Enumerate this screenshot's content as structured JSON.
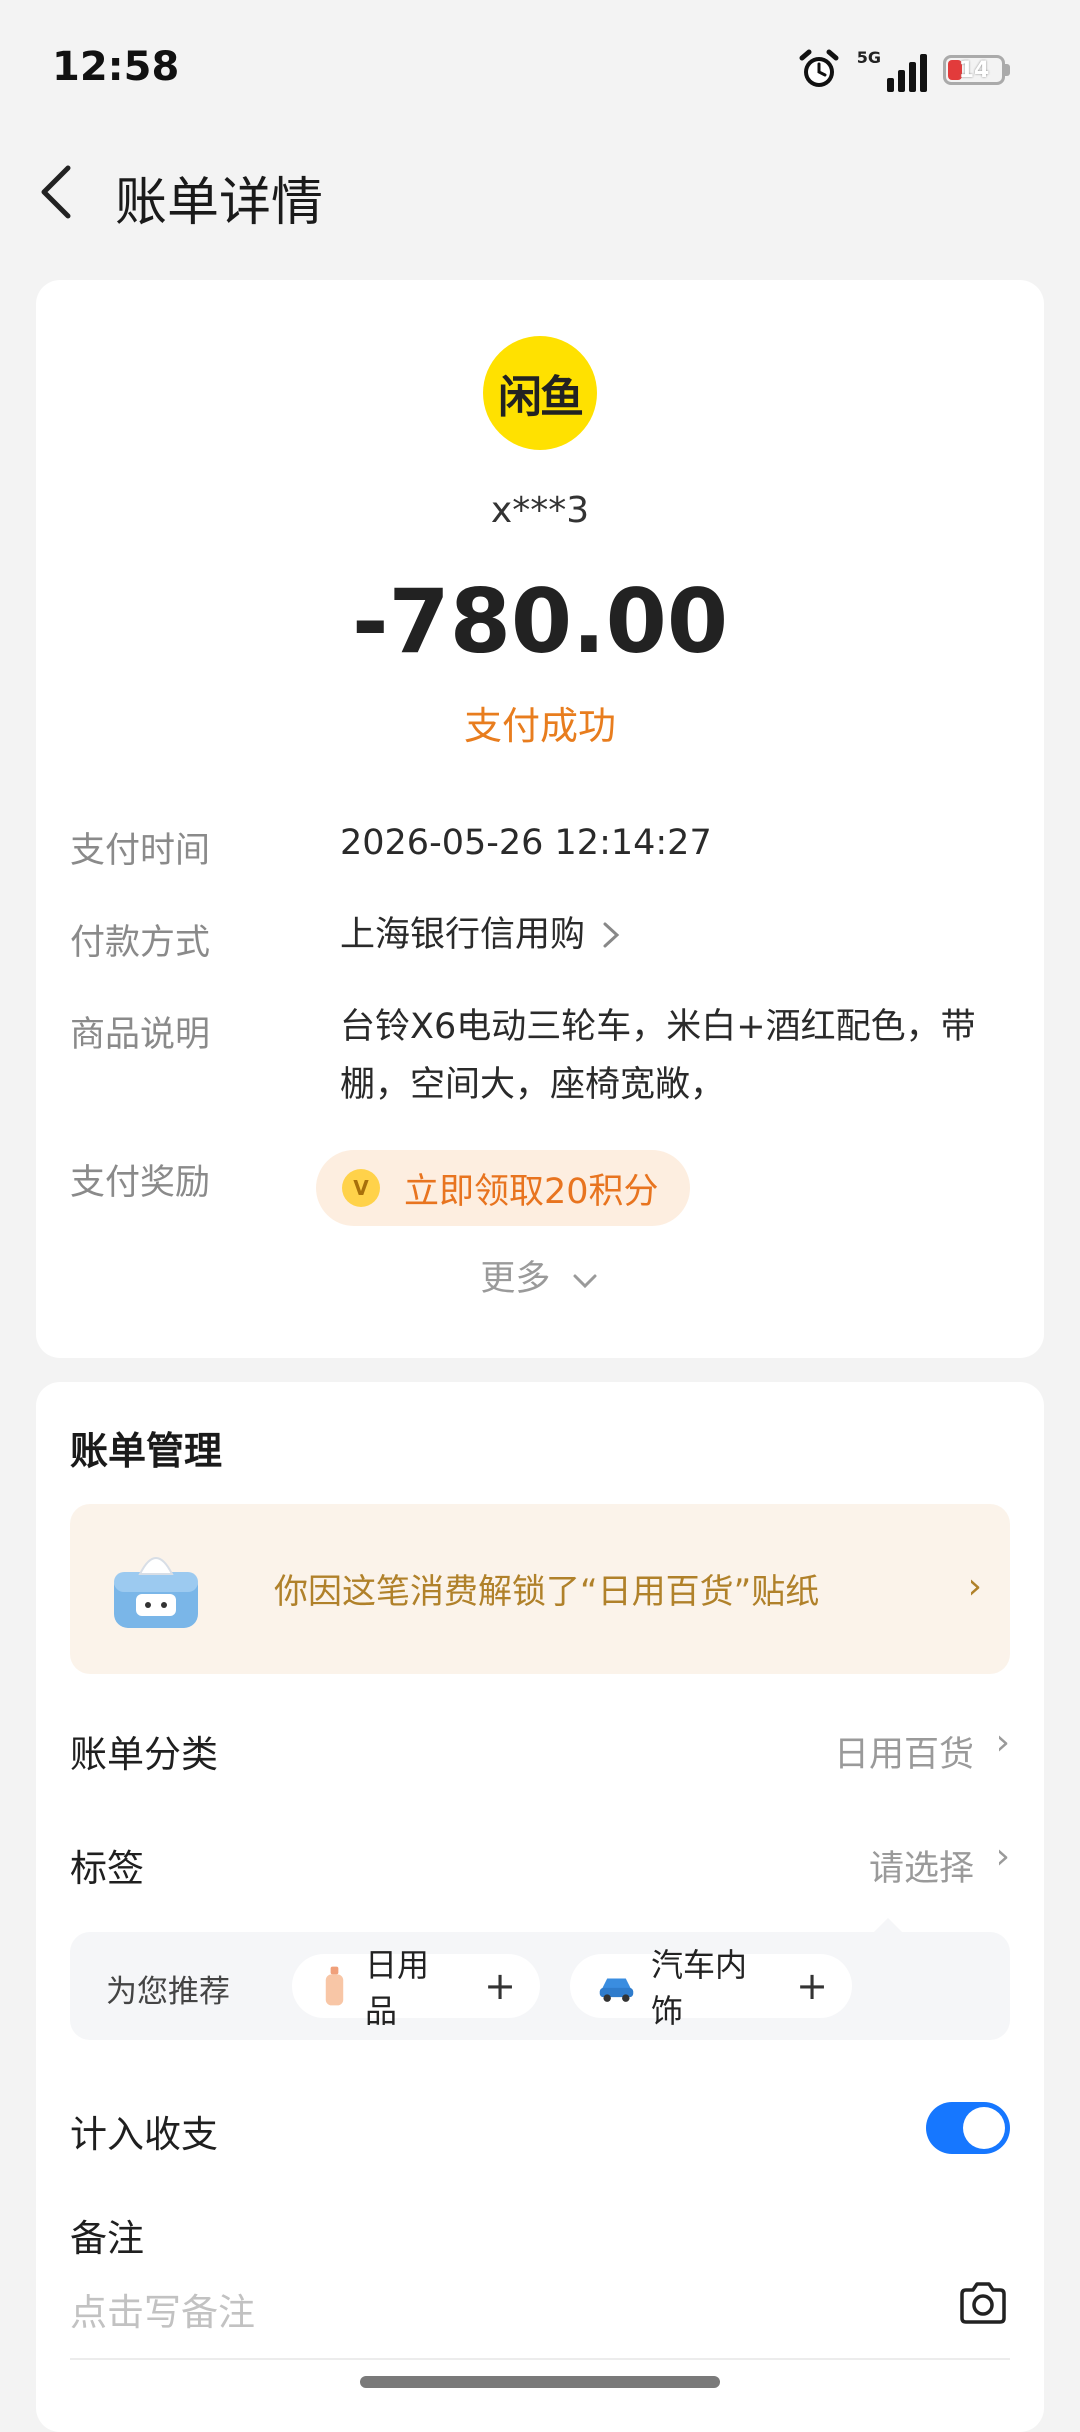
{
  "status_bar": {
    "time": "12:58",
    "network": "5G",
    "battery": "14",
    "icons": [
      "alarm-icon",
      "signal-icon",
      "battery-icon"
    ]
  },
  "header": {
    "title": "账单详情",
    "back_icon": "chevron-left-icon"
  },
  "summary": {
    "merchant_logo_text": "闲鱼",
    "merchant": "x***3",
    "amount": "-780.00",
    "status": "支付成功",
    "status_color": "#e87d1e"
  },
  "details": [
    {
      "label": "支付时间",
      "value": "2026-05-26 12:14:27"
    },
    {
      "label": "付款方式",
      "value": "上海银行信用购"
    },
    {
      "label": "商品说明",
      "value_line1": "台铃X6电动三轮车，米白+酒红配色，带",
      "value_line2": "棚，空间大，座椅宽敞，"
    },
    {
      "label": "支付奖励",
      "value": "立即领取20积分"
    }
  ],
  "more_label": "更多",
  "management": {
    "title": "账单管理",
    "banner_text": "你因这笔消费解锁了“日用百货”贴纸",
    "category_label": "账单分类",
    "category_value": "日用百货",
    "tag_label": "标签",
    "tag_value": "请选择",
    "recommend_label": "为您推荐",
    "recommend_chips": [
      {
        "label": "日用品",
        "icon": "bottle-icon"
      },
      {
        "label": "汽车内饰",
        "icon": "car-icon"
      }
    ],
    "include_label": "计入收支",
    "include_on": true,
    "note_label": "备注",
    "note_placeholder": "点击写备注",
    "accent_color": "#1677ff"
  }
}
